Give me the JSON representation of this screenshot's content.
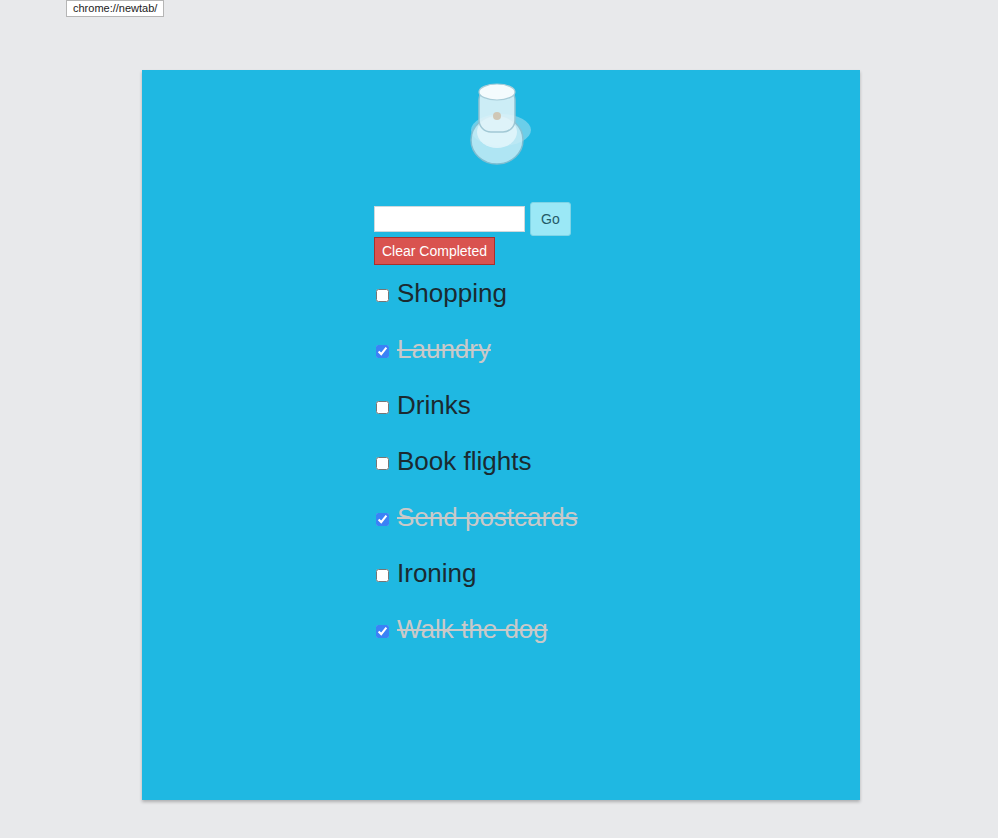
{
  "tooltip": "chrome://newtab/",
  "new_item": {
    "value": "",
    "button": "Go"
  },
  "clear_button": "Clear Completed",
  "items": [
    {
      "label": "Shopping",
      "checked": false
    },
    {
      "label": "Laundry",
      "checked": true
    },
    {
      "label": "Drinks",
      "checked": false
    },
    {
      "label": "Book flights",
      "checked": false
    },
    {
      "label": "Send postcards",
      "checked": true
    },
    {
      "label": "Ironing",
      "checked": false
    },
    {
      "label": "Walk the dog",
      "checked": true
    }
  ]
}
